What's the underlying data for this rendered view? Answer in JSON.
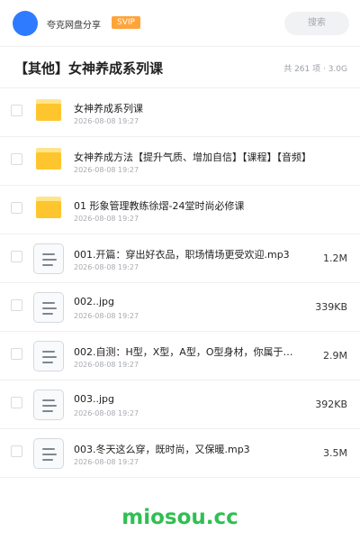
{
  "header": {
    "share_label": "夸克网盘分享",
    "svip_badge": "SVIP",
    "search_label": "搜索"
  },
  "title_bar": {
    "title": "【其他】女神养成系列课",
    "summary": "共 261 项 · 3.0G"
  },
  "files": [
    {
      "type": "folder",
      "name": "女神养成系列课",
      "date": "2026-08-08 19:27",
      "size": ""
    },
    {
      "type": "folder",
      "name": "女神养成方法【提升气质、增加自信】【课程】【音频】",
      "date": "2026-08-08 19:27",
      "size": ""
    },
    {
      "type": "folder",
      "name": "01 形象管理教练徐熠-24堂时尚必修课",
      "date": "2026-08-08 19:27",
      "size": ""
    },
    {
      "type": "file",
      "name": "001.开篇：穿出好衣品，职场情场更受欢迎.mp3",
      "date": "2026-08-08 19:27",
      "size": "1.2M"
    },
    {
      "type": "file",
      "name": "002..jpg",
      "date": "2026-08-08 19:27",
      "size": "339KB"
    },
    {
      "type": "file",
      "name": "002.自测：H型，X型，A型，O型身材，你属于哪…",
      "date": "2026-08-08 19:27",
      "size": "2.9M"
    },
    {
      "type": "file",
      "name": "003..jpg",
      "date": "2026-08-08 19:27",
      "size": "392KB"
    },
    {
      "type": "file",
      "name": "003.冬天这么穿，既时尚，又保暖.mp3",
      "date": "2026-08-08 19:27",
      "size": "3.5M"
    }
  ],
  "icons": {
    "folder": "folder-icon",
    "file": "document-icon"
  },
  "colors": {
    "avatar": "#2f7bff",
    "svip": "#ffa43a",
    "folder": "#ffc52e",
    "watermark": "#2fbf52"
  },
  "watermark": "miosou.cc"
}
